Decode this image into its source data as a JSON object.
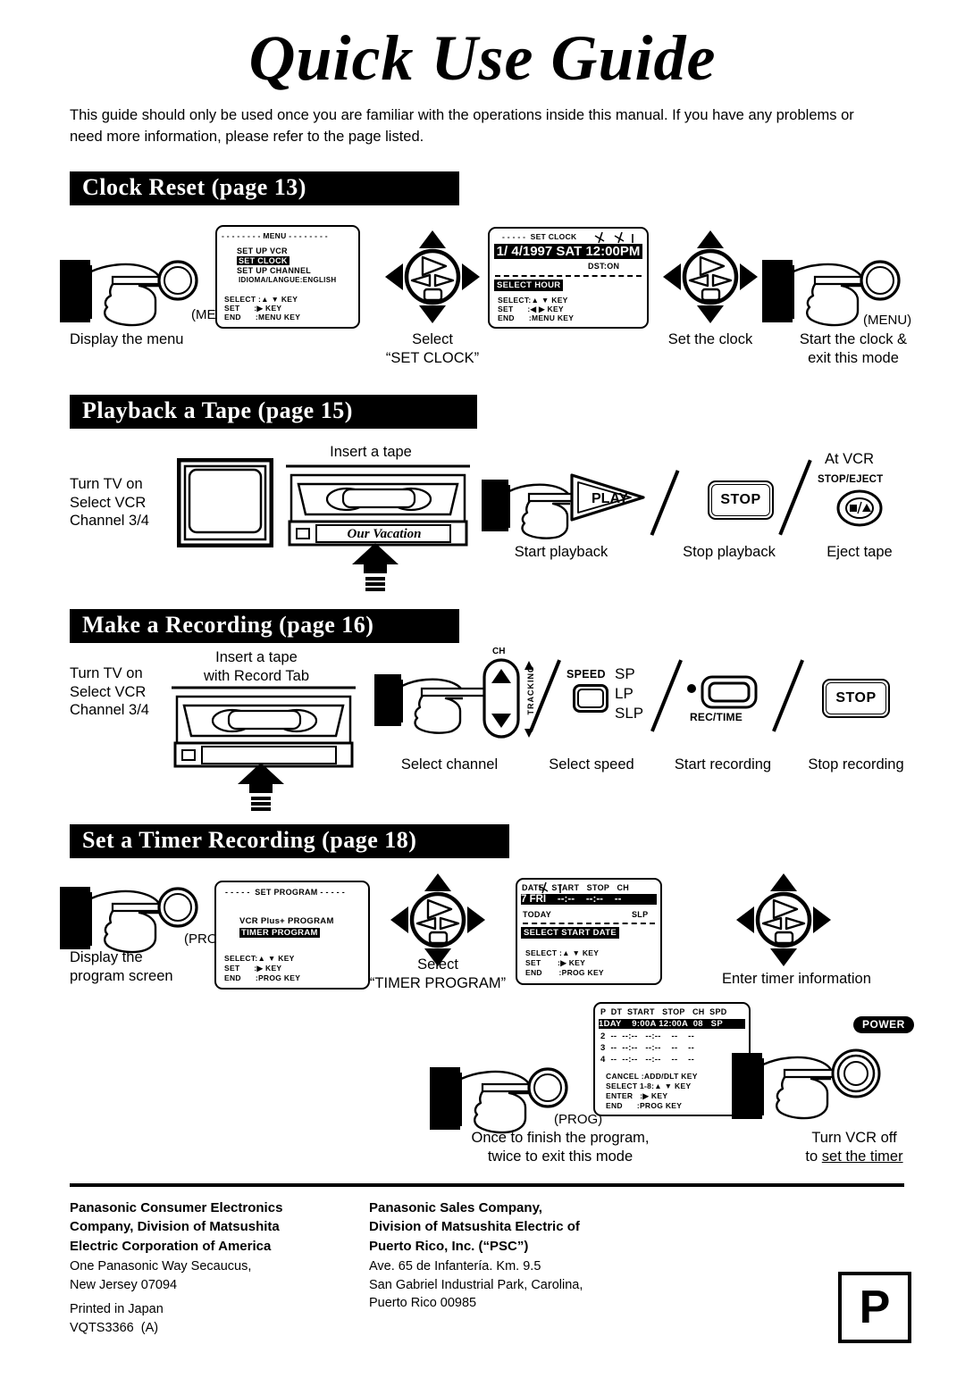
{
  "document": {
    "title": "Quick Use Guide",
    "intro": "This guide should only be used once you are familiar with the operations inside this manual. If you have any problems or need more information, please refer to the page listed."
  },
  "sections": [
    {
      "id": "clock-reset",
      "heading": "Clock Reset (page 13)",
      "steps": [
        {
          "caption": "Display the menu",
          "button_label": "(MENU)"
        },
        {
          "caption": "Select\n“SET CLOCK”"
        },
        {
          "caption": "Set the clock"
        },
        {
          "caption": "Start the clock &\nexit this mode",
          "button_label": "(MENU)"
        }
      ],
      "osd_menu": {
        "title": "MENU",
        "items": [
          "SET UP VCR",
          "SET CLOCK",
          "SET UP CHANNEL",
          "IDIOMA/LANGUE:ENGLISH"
        ],
        "highlighted": "SET CLOCK",
        "legend": [
          "SELECT :▲ ▼ KEY",
          "SET      :▶ KEY",
          "END      :MENU KEY"
        ]
      },
      "osd_clock": {
        "title": "SET CLOCK",
        "datetime": "1/ 4/1997 SAT 12:00PM",
        "dst": "DST:ON",
        "status": "SELECT HOUR",
        "legend": [
          "SELECT:▲ ▼ KEY",
          "SET      :◀ ▶ KEY",
          "END      :MENU KEY"
        ]
      }
    },
    {
      "id": "playback-a-tape",
      "heading": "Playback a Tape (page 15)",
      "tv_instruction": "Turn TV on\nSelect VCR\nChannel 3/4",
      "insert_label": "Insert a tape",
      "tape_label": "Our Vacation",
      "steps": [
        {
          "caption": "Start playback",
          "button_label": "PLAY"
        },
        {
          "caption": "Stop playback",
          "button_label": "STOP"
        },
        {
          "caption": "Eject tape",
          "button_label": "□/▲",
          "top_label": "At VCR",
          "sub_label": "STOP/EJECT"
        }
      ]
    },
    {
      "id": "make-a-recording",
      "heading": "Make a Recording (page 16)",
      "tv_instruction": "Turn TV on\nSelect VCR\nChannel 3/4",
      "insert_label": "Insert a tape\nwith Record Tab",
      "channel_label": "CH",
      "tracking_label": "TRACKING",
      "steps": [
        {
          "caption": "Select channel"
        },
        {
          "caption": "Select speed",
          "button_label": "SPEED",
          "options": [
            "SP",
            "LP",
            "SLP"
          ]
        },
        {
          "caption": "Start recording",
          "button_label": "REC/TIME"
        },
        {
          "caption": "Stop recording",
          "button_label": "STOP"
        }
      ]
    },
    {
      "id": "set-a-timer-recording",
      "heading": "Set a Timer Recording (page 18)",
      "steps": [
        {
          "caption": "Display the\nprogram screen",
          "button_label": "(PROG)"
        },
        {
          "caption": "Select\n“TIMER PROGRAM”"
        },
        {
          "caption": "Enter timer information"
        },
        {
          "caption": "Once to finish the program,\ntwice to exit this mode",
          "button_label": "(PROG)"
        },
        {
          "caption": "Turn VCR off\nto set the timer",
          "caption_underline": "set the timer",
          "button_label": "POWER"
        }
      ],
      "osd_program": {
        "title": "SET PROGRAM",
        "items": [
          "VCR Plus+ PROGRAM",
          "TIMER PROGRAM"
        ],
        "highlighted": "TIMER PROGRAM",
        "legend": [
          "SELECT:▲ ▼ KEY",
          "SET      :▶ KEY",
          "END      :PROG KEY"
        ]
      },
      "osd_timer_entry": {
        "headers": [
          "DATE",
          "START",
          "STOP",
          "CH"
        ],
        "row": "7 FRI    --:--    --:--    --",
        "today": "TODAY",
        "speed": "SLP",
        "status": "SELECT START DATE",
        "legend": [
          "SELECT :▲ ▼ KEY",
          "SET       :▶ KEY",
          "END       :PROG KEY"
        ]
      },
      "osd_timer_list": {
        "headers": [
          "P",
          "DT",
          "START",
          "STOP",
          "CH",
          "SPD"
        ],
        "rows": [
          {
            "p": "1",
            "dt": "DAY",
            "start": "9:00A",
            "stop": "12:00A",
            "ch": "08",
            "spd": "SP",
            "highlighted": true
          },
          {
            "p": "2",
            "dt": "--",
            "start": "--:--",
            "stop": "--:--",
            "ch": "--",
            "spd": "--",
            "highlighted": false
          },
          {
            "p": "3",
            "dt": "--",
            "start": "--:--",
            "stop": "--:--",
            "ch": "--",
            "spd": "--",
            "highlighted": false
          },
          {
            "p": "4",
            "dt": "--",
            "start": "--:--",
            "stop": "--:--",
            "ch": "--",
            "spd": "--",
            "highlighted": false
          }
        ],
        "legend": [
          "CANCEL :ADD/DLT KEY",
          "SELECT 1-8:▲ ▼ KEY",
          "ENTER   :▶ KEY",
          "END      :PROG KEY"
        ]
      }
    }
  ],
  "footer": {
    "left": {
      "bold": "Panasonic Consumer Electronics\nCompany, Division of Matsushita\nElectric Corporation of America",
      "plain": "One Panasonic Way Secaucus,\nNew Jersey 07094",
      "printed": "Printed in Japan\nVQTS3366  (A)"
    },
    "right": {
      "bold": "Panasonic Sales Company,\nDivision of Matsushita Electric of\nPuerto Rico, Inc. (“PSC”)",
      "plain": "Ave. 65 de Infantería. Km. 9.5\nSan Gabriel Industrial Park, Carolina,\nPuerto Rico 00985"
    },
    "logo": "P"
  }
}
